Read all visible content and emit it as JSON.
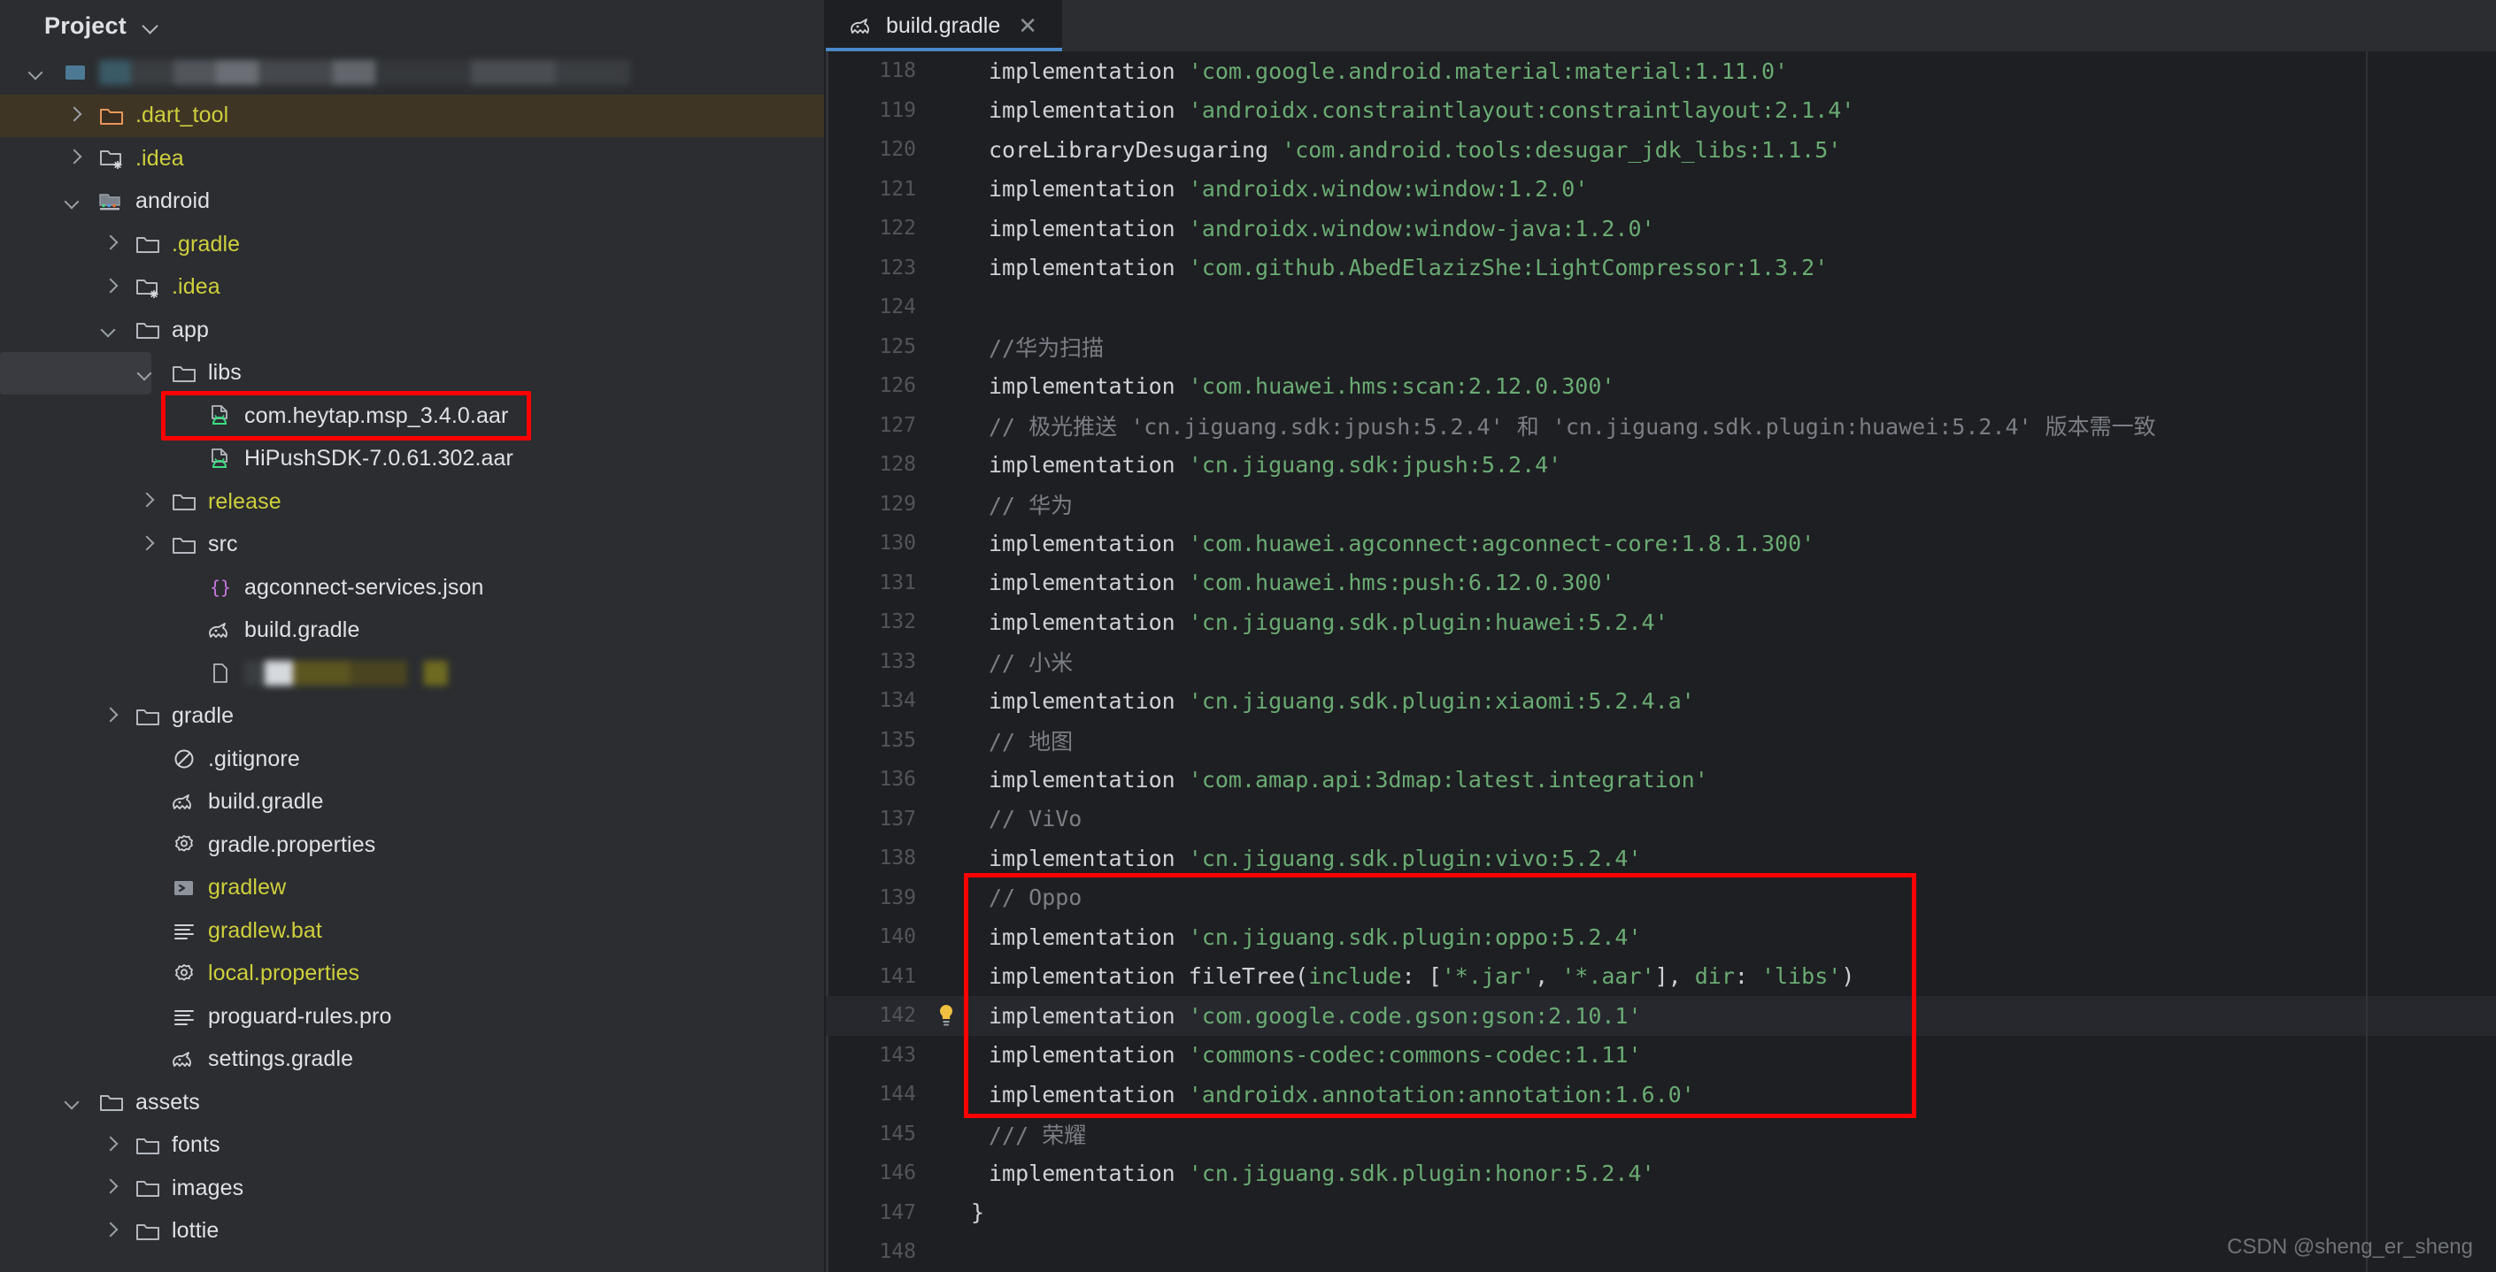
{
  "sidebar": {
    "header": {
      "title": "Project",
      "collapse_icon": "chevron-down-icon"
    },
    "tree": [
      {
        "label": "",
        "redacted": true,
        "indent": 0,
        "arrow": "down",
        "icon": "project-root-icon",
        "color": "#dfe1e5",
        "state": "normal"
      },
      {
        "label": ".dart_tool",
        "indent": 1,
        "arrow": "right",
        "icon": "folder-excluded-icon",
        "color": "#cfcf3c",
        "state": "highlighted"
      },
      {
        "label": ".idea",
        "indent": 1,
        "arrow": "right",
        "icon": "folder-ignored-icon",
        "color": "#cfcf3c",
        "state": "normal"
      },
      {
        "label": "android",
        "indent": 1,
        "arrow": "down",
        "icon": "android-module-icon",
        "color": "#dfe1e5",
        "state": "normal"
      },
      {
        "label": ".gradle",
        "indent": 2,
        "arrow": "right",
        "icon": "folder-icon",
        "color": "#cfcf3c",
        "state": "normal"
      },
      {
        "label": ".idea",
        "indent": 2,
        "arrow": "right",
        "icon": "folder-ignored-icon",
        "color": "#cfcf3c",
        "state": "normal"
      },
      {
        "label": "app",
        "indent": 2,
        "arrow": "down",
        "icon": "folder-icon",
        "color": "#dfe1e5",
        "state": "normal"
      },
      {
        "label": "libs",
        "indent": 3,
        "arrow": "down",
        "icon": "folder-icon",
        "color": "#dfe1e5",
        "state": "selected"
      },
      {
        "label": "com.heytap.msp_3.4.0.aar",
        "indent": 4,
        "arrow": "none",
        "icon": "aar-file-icon",
        "color": "#dfe1e5",
        "state": "boxed"
      },
      {
        "label": "HiPushSDK-7.0.61.302.aar",
        "indent": 4,
        "arrow": "none",
        "icon": "aar-file-icon",
        "color": "#dfe1e5",
        "state": "normal"
      },
      {
        "label": "release",
        "indent": 3,
        "arrow": "right",
        "icon": "folder-icon",
        "color": "#cfcf3c",
        "state": "normal"
      },
      {
        "label": "src",
        "indent": 3,
        "arrow": "right",
        "icon": "folder-icon",
        "color": "#dfe1e5",
        "state": "normal"
      },
      {
        "label": "agconnect-services.json",
        "indent": 4,
        "arrow": "none",
        "icon": "json-file-icon",
        "color": "#dfe1e5",
        "state": "normal"
      },
      {
        "label": "build.gradle",
        "indent": 4,
        "arrow": "none",
        "icon": "gradle-file-icon",
        "color": "#dfe1e5",
        "state": "normal"
      },
      {
        "label": "",
        "redacted": true,
        "indent": 4,
        "arrow": "none",
        "icon": "file-icon",
        "color": "#cfcf3c",
        "state": "normal"
      },
      {
        "label": "gradle",
        "indent": 2,
        "arrow": "right",
        "icon": "folder-icon",
        "color": "#dfe1e5",
        "state": "normal"
      },
      {
        "label": ".gitignore",
        "indent": 3,
        "arrow": "none",
        "icon": "gitignore-file-icon",
        "color": "#dfe1e5",
        "state": "normal"
      },
      {
        "label": "build.gradle",
        "indent": 3,
        "arrow": "none",
        "icon": "gradle-file-icon",
        "color": "#dfe1e5",
        "state": "normal"
      },
      {
        "label": "gradle.properties",
        "indent": 3,
        "arrow": "none",
        "icon": "properties-file-icon",
        "color": "#dfe1e5",
        "state": "normal"
      },
      {
        "label": "gradlew",
        "indent": 3,
        "arrow": "none",
        "icon": "shell-script-icon",
        "color": "#cfcf3c",
        "state": "normal"
      },
      {
        "label": "gradlew.bat",
        "indent": 3,
        "arrow": "none",
        "icon": "text-file-icon",
        "color": "#cfcf3c",
        "state": "normal"
      },
      {
        "label": "local.properties",
        "indent": 3,
        "arrow": "none",
        "icon": "properties-file-icon",
        "color": "#cfcf3c",
        "state": "normal"
      },
      {
        "label": "proguard-rules.pro",
        "indent": 3,
        "arrow": "none",
        "icon": "text-file-icon",
        "color": "#dfe1e5",
        "state": "normal"
      },
      {
        "label": "settings.gradle",
        "indent": 3,
        "arrow": "none",
        "icon": "gradle-file-icon",
        "color": "#dfe1e5",
        "state": "normal"
      },
      {
        "label": "assets",
        "indent": 1,
        "arrow": "down",
        "icon": "folder-icon",
        "color": "#dfe1e5",
        "state": "normal"
      },
      {
        "label": "fonts",
        "indent": 2,
        "arrow": "right",
        "icon": "folder-icon",
        "color": "#dfe1e5",
        "state": "normal"
      },
      {
        "label": "images",
        "indent": 2,
        "arrow": "right",
        "icon": "folder-icon",
        "color": "#dfe1e5",
        "state": "normal"
      },
      {
        "label": "lottie",
        "indent": 2,
        "arrow": "right",
        "icon": "folder-icon",
        "color": "#dfe1e5",
        "state": "normal"
      }
    ]
  },
  "editor": {
    "tab": {
      "label": "build.gradle",
      "icon": "gradle-file-icon",
      "close_icon": "close-icon"
    },
    "first_line_number": 118,
    "current_line": 142,
    "bulb_line": 142,
    "lines": [
      {
        "n": 118,
        "tokens": [
          {
            "t": "implementation ",
            "c": "kw"
          },
          {
            "t": "'com.google.android.material:material:1.11.0'",
            "c": "str"
          }
        ]
      },
      {
        "n": 119,
        "tokens": [
          {
            "t": "implementation ",
            "c": "kw"
          },
          {
            "t": "'androidx.constraintlayout:constraintlayout:2.1.4'",
            "c": "str"
          }
        ]
      },
      {
        "n": 120,
        "tokens": [
          {
            "t": "coreLibraryDesugaring ",
            "c": "kw"
          },
          {
            "t": "'com.android.tools:desugar_jdk_libs:1.1.5'",
            "c": "str"
          }
        ]
      },
      {
        "n": 121,
        "tokens": [
          {
            "t": "implementation ",
            "c": "kw"
          },
          {
            "t": "'androidx.window:window:1.2.0'",
            "c": "str"
          }
        ]
      },
      {
        "n": 122,
        "tokens": [
          {
            "t": "implementation ",
            "c": "kw"
          },
          {
            "t": "'androidx.window:window-java:1.2.0'",
            "c": "str"
          }
        ]
      },
      {
        "n": 123,
        "tokens": [
          {
            "t": "implementation ",
            "c": "kw"
          },
          {
            "t": "'com.github.AbedElazizShe:LightCompressor:1.3.2'",
            "c": "str"
          }
        ]
      },
      {
        "n": 124,
        "tokens": []
      },
      {
        "n": 125,
        "tokens": [
          {
            "t": "//华为扫描",
            "c": "cmt"
          }
        ]
      },
      {
        "n": 126,
        "tokens": [
          {
            "t": "implementation ",
            "c": "kw"
          },
          {
            "t": "'com.huawei.hms:scan:2.12.0.300'",
            "c": "str"
          }
        ]
      },
      {
        "n": 127,
        "tokens": [
          {
            "t": "// 极光推送 ",
            "c": "cmt"
          },
          {
            "t": "'cn.jiguang.sdk:jpush:5.2.4'",
            "c": "cmt"
          },
          {
            "t": " 和 ",
            "c": "cmt"
          },
          {
            "t": "'cn.jiguang.sdk.plugin:huawei:5.2.4'",
            "c": "cmt"
          },
          {
            "t": " 版本需一致",
            "c": "cmt"
          }
        ]
      },
      {
        "n": 128,
        "tokens": [
          {
            "t": "implementation ",
            "c": "kw"
          },
          {
            "t": "'cn.jiguang.sdk:jpush:5.2.4'",
            "c": "str"
          }
        ]
      },
      {
        "n": 129,
        "tokens": [
          {
            "t": "// 华为",
            "c": "cmt"
          }
        ]
      },
      {
        "n": 130,
        "tokens": [
          {
            "t": "implementation ",
            "c": "kw"
          },
          {
            "t": "'com.huawei.agconnect:agconnect-core:1.8.1.300'",
            "c": "str"
          }
        ]
      },
      {
        "n": 131,
        "tokens": [
          {
            "t": "implementation ",
            "c": "kw"
          },
          {
            "t": "'com.huawei.hms:push:6.12.0.300'",
            "c": "str"
          }
        ]
      },
      {
        "n": 132,
        "tokens": [
          {
            "t": "implementation ",
            "c": "kw"
          },
          {
            "t": "'cn.jiguang.sdk.plugin:huawei:5.2.4'",
            "c": "str"
          }
        ]
      },
      {
        "n": 133,
        "tokens": [
          {
            "t": "// 小米",
            "c": "cmt"
          }
        ]
      },
      {
        "n": 134,
        "tokens": [
          {
            "t": "implementation ",
            "c": "kw"
          },
          {
            "t": "'cn.jiguang.sdk.plugin:xiaomi:5.2.4.a'",
            "c": "str"
          }
        ]
      },
      {
        "n": 135,
        "tokens": [
          {
            "t": "// 地图",
            "c": "cmt"
          }
        ]
      },
      {
        "n": 136,
        "tokens": [
          {
            "t": "implementation ",
            "c": "kw"
          },
          {
            "t": "'com.amap.api:3dmap:latest.integration'",
            "c": "str"
          }
        ]
      },
      {
        "n": 137,
        "tokens": [
          {
            "t": "// ViVo",
            "c": "cmt"
          }
        ]
      },
      {
        "n": 138,
        "tokens": [
          {
            "t": "implementation ",
            "c": "kw"
          },
          {
            "t": "'cn.jiguang.sdk.plugin:vivo:5.2.4'",
            "c": "str"
          }
        ]
      },
      {
        "n": 139,
        "tokens": [
          {
            "t": "// Oppo",
            "c": "cmt"
          }
        ]
      },
      {
        "n": 140,
        "tokens": [
          {
            "t": "implementation ",
            "c": "kw"
          },
          {
            "t": "'cn.jiguang.sdk.plugin:oppo:5.2.4'",
            "c": "str"
          }
        ]
      },
      {
        "n": 141,
        "tokens": [
          {
            "t": "implementation fileTree(",
            "c": "kw"
          },
          {
            "t": "include",
            "c": "str"
          },
          {
            "t": ": [",
            "c": "punc"
          },
          {
            "t": "'*.jar'",
            "c": "str"
          },
          {
            "t": ", ",
            "c": "punc"
          },
          {
            "t": "'*.aar'",
            "c": "str"
          },
          {
            "t": "], ",
            "c": "punc"
          },
          {
            "t": "dir",
            "c": "str"
          },
          {
            "t": ": ",
            "c": "punc"
          },
          {
            "t": "'libs'",
            "c": "str"
          },
          {
            "t": ")",
            "c": "punc"
          }
        ]
      },
      {
        "n": 142,
        "tokens": [
          {
            "t": "implementation ",
            "c": "kw"
          },
          {
            "t": "'com.google.code.gson:gson:2.10.1'",
            "c": "str"
          }
        ]
      },
      {
        "n": 143,
        "tokens": [
          {
            "t": "implementation ",
            "c": "kw"
          },
          {
            "t": "'commons-codec:commons-codec:1.11'",
            "c": "str"
          }
        ]
      },
      {
        "n": 144,
        "tokens": [
          {
            "t": "implementation ",
            "c": "kw"
          },
          {
            "t": "'androidx.annotation:annotation:1.6.0'",
            "c": "str"
          }
        ]
      },
      {
        "n": 145,
        "tokens": [
          {
            "t": "/// 荣耀",
            "c": "cmt"
          }
        ]
      },
      {
        "n": 146,
        "tokens": [
          {
            "t": "implementation ",
            "c": "kw"
          },
          {
            "t": "'cn.jiguang.sdk.plugin:honor:5.2.4'",
            "c": "str"
          }
        ]
      },
      {
        "n": 147,
        "tokens": [
          {
            "t": "}",
            "c": "punc"
          }
        ],
        "noindent": true
      },
      {
        "n": 148,
        "tokens": []
      }
    ],
    "highlight_box": {
      "from_line": 139,
      "to_line": 144,
      "color": "#ff0000"
    }
  },
  "watermark": {
    "text": "CSDN @sheng_er_sheng"
  },
  "colors": {
    "background": "#2b2d30",
    "editor_background": "#1e1f22",
    "accent": "#4a88c7",
    "string": "#6aab73",
    "comment": "#7a7e85",
    "keyword": "#cfd2d6",
    "annotation_red": "#ff0000",
    "folder_yellow": "#cfcf3c"
  }
}
